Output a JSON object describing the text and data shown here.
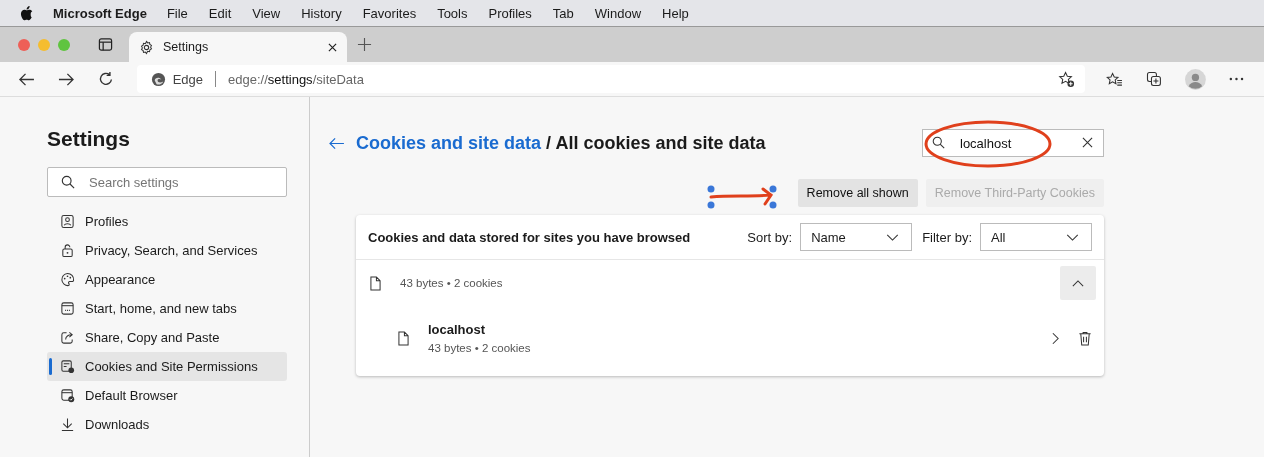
{
  "menu_bar": {
    "app_name": "Microsoft Edge",
    "items": [
      "File",
      "Edit",
      "View",
      "History",
      "Favorites",
      "Tools",
      "Profiles",
      "Tab",
      "Window",
      "Help"
    ]
  },
  "tab": {
    "title": "Settings"
  },
  "address_bar": {
    "site_label": "Edge",
    "url_scheme": "edge://",
    "url_host": "settings",
    "url_path": "/siteData"
  },
  "sidebar": {
    "title": "Settings",
    "search": {
      "placeholder": "Search settings"
    },
    "items": [
      {
        "label": "Profiles",
        "selected": false
      },
      {
        "label": "Privacy, Search, and Services",
        "selected": false
      },
      {
        "label": "Appearance",
        "selected": false
      },
      {
        "label": "Start, home, and new tabs",
        "selected": false
      },
      {
        "label": "Share, Copy and Paste",
        "selected": false
      },
      {
        "label": "Cookies and Site Permissions",
        "selected": true
      },
      {
        "label": "Default Browser",
        "selected": false
      },
      {
        "label": "Downloads",
        "selected": false
      }
    ]
  },
  "page": {
    "breadcrumb_link": "Cookies and site data",
    "breadcrumb_current": "/ All cookies and site data",
    "search": {
      "value": "localhost"
    },
    "buttons": [
      {
        "label": "Remove all shown",
        "disabled": false
      },
      {
        "label": "Remove Third-Party Cookies",
        "disabled": true
      }
    ],
    "card": {
      "title": "Cookies and data stored for sites you have browsed",
      "sort_label": "Sort by:",
      "sort_value": "Name",
      "filter_label": "Filter by:",
      "filter_value": "All",
      "group": {
        "summary": "43 bytes • 2 cookies",
        "expanded": true,
        "sites": [
          {
            "name": "localhost",
            "summary": "43 bytes • 2 cookies"
          }
        ]
      }
    }
  }
}
